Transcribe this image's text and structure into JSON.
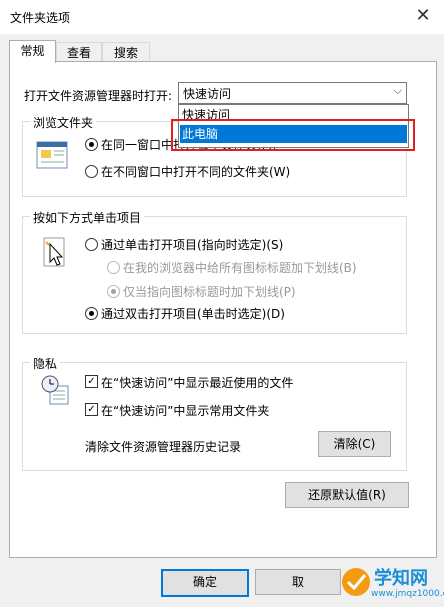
{
  "dialog": {
    "title": "文件夹选项",
    "close": "✕"
  },
  "tabs": [
    "常规",
    "查看",
    "搜索"
  ],
  "open_explorer": {
    "label": "打开文件资源管理器时打开:",
    "value": "快速访问",
    "options": [
      "快速访问",
      "此电脑"
    ],
    "highlighted": "此电脑"
  },
  "browse": {
    "legend": "浏览文件夹",
    "same_window": "在同一窗口中打开每个文件夹(M)",
    "diff_window": "在不同窗口中打开不同的文件夹(W)"
  },
  "click": {
    "legend": "按如下方式单击项目",
    "single": "通过单击打开项目(指向时选定)(S)",
    "underline_all": "在我的浏览器中给所有图标标题加下划线(B)",
    "underline_hover": "仅当指向图标标题时加下划线(P)",
    "double": "通过双击打开项目(单击时选定)(D)"
  },
  "privacy": {
    "legend": "隐私",
    "recent_files": "在“快速访问”中显示最近使用的文件",
    "frequent_folders": "在“快速访问”中显示常用文件夹",
    "clear_label": "清除文件资源管理器历史记录",
    "clear_button": "清除(C)"
  },
  "restore_button": "还原默认值(R)",
  "footer": {
    "ok": "确定",
    "cancel": "取"
  },
  "watermark": {
    "brand": "学知网",
    "url": "www.jmqz1000.com"
  }
}
